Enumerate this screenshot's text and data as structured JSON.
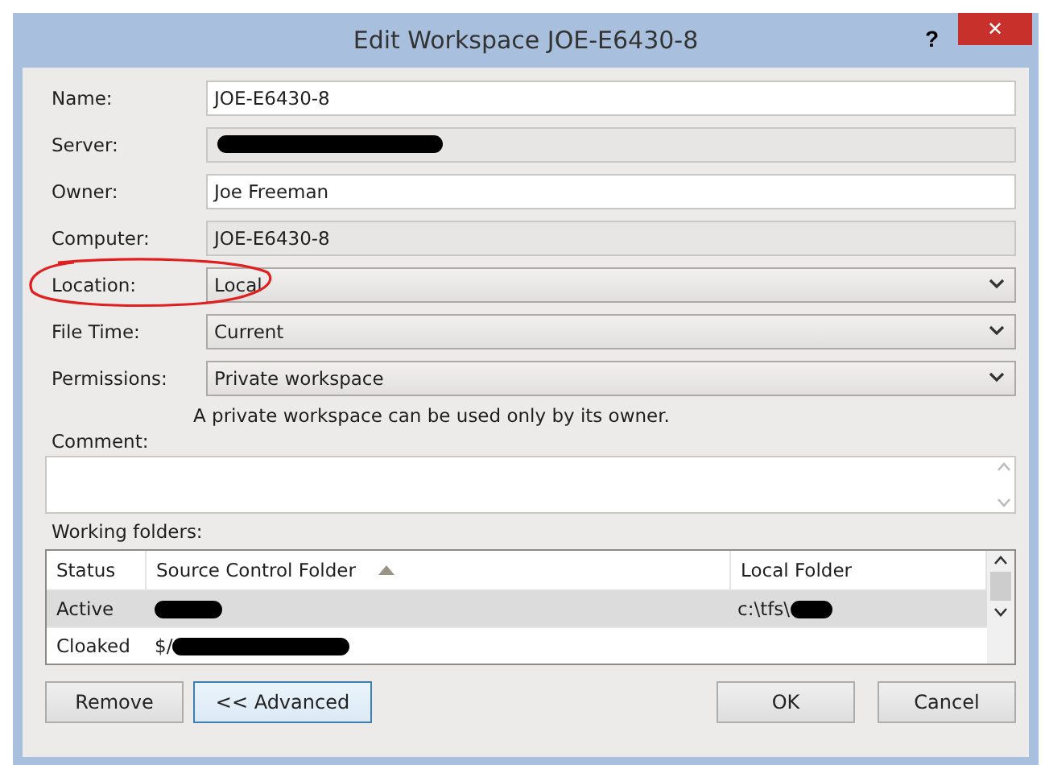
{
  "window": {
    "title": "Edit Workspace JOE-E6430-8",
    "help": "?",
    "close": "✕"
  },
  "fields": [
    {
      "label": "Name:",
      "kind": "text",
      "value": "JOE-E6430-8",
      "redacted": false,
      "circled": false
    },
    {
      "label": "Server:",
      "kind": "readonly",
      "redacted": true,
      "circled": false
    },
    {
      "label": "Owner:",
      "kind": "text",
      "value": "Joe Freeman",
      "redacted": false,
      "circled": false
    },
    {
      "label": "Computer:",
      "kind": "readonly",
      "value": "JOE-E6430-8",
      "redacted": false,
      "circled": false
    },
    {
      "label": "Location:",
      "kind": "dropdown",
      "value": "Local",
      "redacted": false,
      "circled": true
    },
    {
      "label": "File Time:",
      "kind": "dropdown",
      "value": "Current",
      "redacted": false,
      "circled": false
    },
    {
      "label": "Permissions:",
      "kind": "dropdown",
      "value": "Private workspace",
      "redacted": false,
      "circled": false
    }
  ],
  "permission_hint": "A private workspace can be used only by its owner.",
  "comment": {
    "label": "Comment:"
  },
  "working_folders": {
    "label": "Working folders:",
    "columns": [
      {
        "label": "Status",
        "sorted": false
      },
      {
        "label": "Source Control Folder",
        "sorted": true
      },
      {
        "label": "Local Folder",
        "sorted": false
      }
    ],
    "rows": [
      {
        "status": "Active",
        "source_redacted": true,
        "local": "c:\\tfs\\",
        "local_redacted": true,
        "selected": true
      },
      {
        "status": "Cloaked",
        "source": "$/",
        "source_redacted": true,
        "local_redacted": false,
        "selected": false
      }
    ]
  },
  "left_buttons": [
    {
      "label": "Remove",
      "focused": false
    },
    {
      "label": "<< Advanced",
      "focused": true
    }
  ],
  "right_buttons": [
    {
      "label": "OK",
      "focused": false
    },
    {
      "label": "Cancel",
      "focused": false
    }
  ]
}
